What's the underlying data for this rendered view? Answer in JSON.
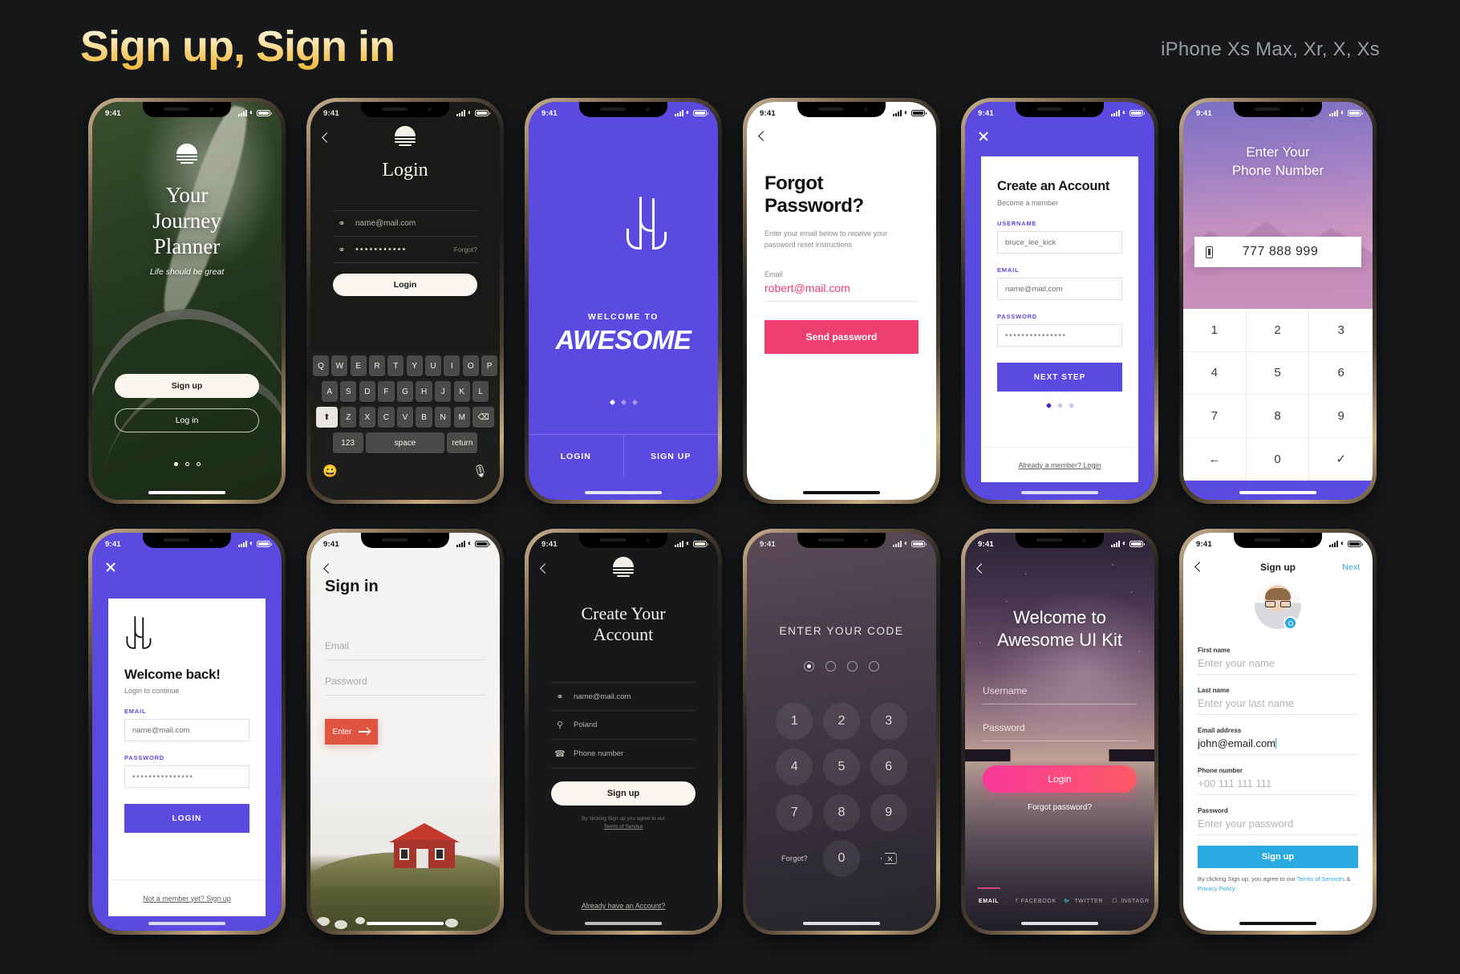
{
  "header": {
    "title": "Sign up, Sign in",
    "subtitle": "iPhone Xs Max, Xr, X, Xs"
  },
  "status_time": "9:41",
  "phones": {
    "journey": {
      "title_line1": "Your",
      "title_line2": "Journey",
      "title_line3": "Planner",
      "tagline": "Life should be great",
      "signup": "Sign up",
      "login": "Log in"
    },
    "login_dark": {
      "title": "Login",
      "email": "name@mail.com",
      "password": "•••••••••••",
      "forgot": "Forgot?",
      "button": "Login",
      "keyboard": {
        "row1": [
          "Q",
          "W",
          "E",
          "R",
          "T",
          "Y",
          "U",
          "I",
          "O",
          "P"
        ],
        "row2": [
          "A",
          "S",
          "D",
          "F",
          "G",
          "H",
          "J",
          "K",
          "L"
        ],
        "row3": [
          "Z",
          "X",
          "C",
          "V",
          "B",
          "N",
          "M"
        ],
        "numbers": "123",
        "space": "space",
        "return": "return"
      }
    },
    "awesome": {
      "welcome_to": "WELCOME TO",
      "brand": "AWESOME",
      "tab_login": "LOGIN",
      "tab_signup": "SIGN UP"
    },
    "forgot": {
      "title_line1": "Forgot",
      "title_line2": "Password?",
      "description": "Enter your email below to receive your password reset instructions",
      "email_label": "Email",
      "email_value": "robert@mail.com",
      "button": "Send password"
    },
    "create_account": {
      "title": "Create an Account",
      "subtitle": "Become a member",
      "username_label": "USERNAME",
      "username_value": "bruce_lee_kick",
      "email_label": "EMAIL",
      "email_value": "name@mail.com",
      "password_label": "PASSWORD",
      "password_value": "•••••••••••••••",
      "button": "NEXT STEP",
      "footer": "Already a member? Login"
    },
    "phone_number": {
      "title_line1": "Enter Your",
      "title_line2": "Phone Number",
      "value": "777 888 999",
      "keys": [
        "1",
        "2",
        "3",
        "4",
        "5",
        "6",
        "7",
        "8",
        "9",
        "←",
        "0",
        "✓"
      ]
    },
    "welcome_back": {
      "title": "Welcome back!",
      "subtitle": "Login to continue",
      "email_label": "EMAIL",
      "email_value": "name@mail.com",
      "password_label": "PASSWORD",
      "password_value": "•••••••••••••••",
      "button": "LOGIN",
      "footer": "Not a member yet? Sign up"
    },
    "sign_in_house": {
      "title": "Sign in",
      "email_placeholder": "Email",
      "password_placeholder": "Password",
      "button": "Enter"
    },
    "create_your_account": {
      "title_line1": "Create Your",
      "title_line2": "Account",
      "email": "name@mail.com",
      "country": "Poland",
      "phone": "Phone number",
      "button": "Sign up",
      "terms_prefix": "By clicking Sign up you agree to our",
      "terms_link": "Terms of Service",
      "footer": "Already have an Account?"
    },
    "enter_code": {
      "title": "ENTER YOUR CODE",
      "keys": [
        "1",
        "2",
        "3",
        "4",
        "5",
        "6",
        "7",
        "8",
        "9"
      ],
      "forgot": "Forgot?",
      "zero": "0",
      "pin_count": 4,
      "pin_filled": 1
    },
    "ui_kit": {
      "title_line1": "Welcome to",
      "title_line2": "Awesome UI Kit",
      "username_placeholder": "Username",
      "password_placeholder": "Password",
      "button": "Login",
      "forgot": "Forgot password?",
      "social": [
        "EMAIL",
        "FACEBOOK",
        "TWITTER",
        "INSTAGR"
      ]
    },
    "signup_blue": {
      "title": "Sign up",
      "next": "Next",
      "fields": [
        {
          "label": "First name",
          "value": "Enter your name",
          "filled": false
        },
        {
          "label": "Last name",
          "value": "Enter your last name",
          "filled": false
        },
        {
          "label": "Email address",
          "value": "john@email.com",
          "filled": true
        },
        {
          "label": "Phone number",
          "value": "+00 111 111 111",
          "filled": false
        },
        {
          "label": "Password",
          "value": "Enter your password",
          "filled": false
        }
      ],
      "button": "Sign up",
      "terms_prefix": "By clicking Sign up, you agree to our ",
      "terms_link1": "Terms of Services",
      "terms_amp": " & ",
      "terms_link2": "Privacy Policy"
    }
  },
  "colors": {
    "page_bg": "#16181a",
    "accent_gold": "#f0c254",
    "purple": "#5a4ae0",
    "pink": "#ed3f6e",
    "blue": "#29abe2",
    "red": "#e05540"
  }
}
